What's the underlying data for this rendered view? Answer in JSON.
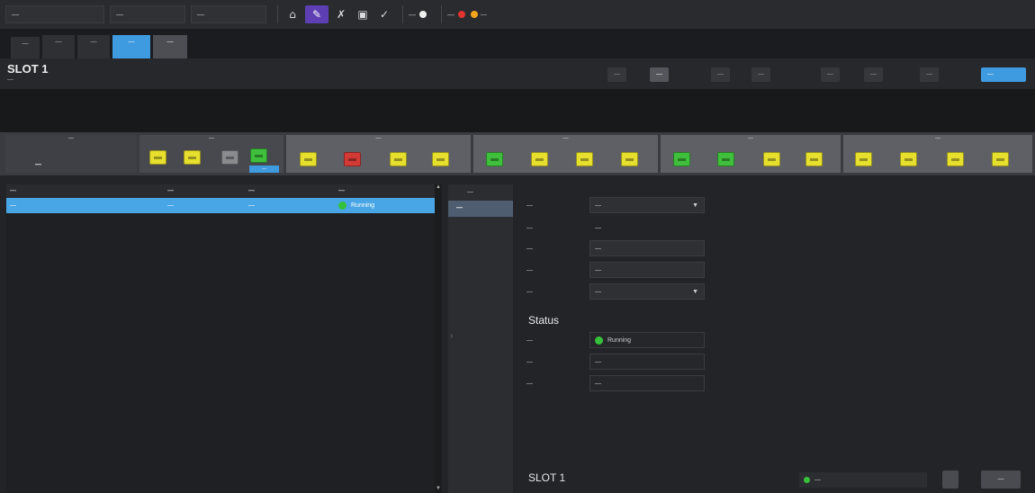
{
  "topbar": {
    "frame_name": "—",
    "frame_type": "—",
    "ip": "—",
    "status_label": "—",
    "alarms_label": "—",
    "alarm_count": "—"
  },
  "frames": [
    {
      "label": "—"
    },
    {
      "label": "—"
    },
    {
      "label": "—"
    },
    {
      "label": "—"
    },
    {
      "label": "—"
    }
  ],
  "slot": {
    "title": "SLOT 1",
    "subtitle": "—",
    "buttons": [
      "—",
      "—",
      "—",
      "—",
      "—",
      "—",
      "—"
    ],
    "primary_button": "—"
  },
  "watermark": "",
  "panel": {
    "groups": [
      "—",
      "—",
      "—",
      "—",
      "—",
      "—"
    ],
    "module_label": "—",
    "selected_port_label": "—"
  },
  "table": {
    "headers": [
      "—",
      "—",
      "—",
      "—"
    ],
    "rows": [
      {
        "name": "—",
        "type": "—",
        "source": "—",
        "state": "Running"
      }
    ]
  },
  "tabs": [
    {
      "label": "—"
    },
    {
      "label": "—"
    }
  ],
  "form": {
    "video_source": {
      "label": "—",
      "value": "—"
    },
    "rx_stream_name": {
      "label": "—",
      "value": "—"
    },
    "stream_name": {
      "label": "—",
      "value": "—"
    },
    "group": {
      "label": "—",
      "value": "—"
    },
    "transport_mode": {
      "label": "—",
      "value": "—"
    }
  },
  "status": {
    "title": "Status",
    "stream_state": {
      "label": "—",
      "value": "Running"
    },
    "video_format": {
      "label": "—",
      "value": "—"
    },
    "stream_type": {
      "label": "—",
      "value": "—"
    }
  },
  "footer": {
    "title": "SLOT 1",
    "config_status": "—",
    "apply_button": "—"
  },
  "colors": {
    "accent": "#3f9be0",
    "running": "#35c23a",
    "port_yellow": "#e6df2e",
    "port_green": "#3fbf3c",
    "port_red": "#d33a36",
    "port_grey": "#8a8b8f"
  }
}
